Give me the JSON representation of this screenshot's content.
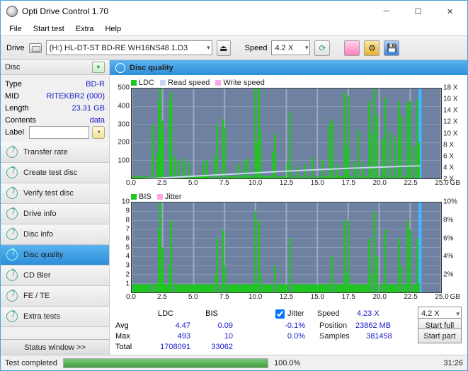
{
  "window": {
    "title": "Opti Drive Control 1.70"
  },
  "menu": {
    "file": "File",
    "start_test": "Start test",
    "extra": "Extra",
    "help": "Help"
  },
  "toolbar": {
    "drive_label": "Drive",
    "drive_value": "(H:)   HL-DT-ST BD-RE  WH16NS48 1.D3",
    "speed_label": "Speed",
    "speed_value": "4.2 X"
  },
  "disc_panel": {
    "header": "Disc",
    "type_k": "Type",
    "type_v": "BD-R",
    "mid_k": "MID",
    "mid_v": "RITEKBR2 (000)",
    "length_k": "Length",
    "length_v": "23.31 GB",
    "contents_k": "Contents",
    "contents_v": "data",
    "label_k": "Label"
  },
  "sidebar": {
    "items": [
      {
        "label": "Transfer rate"
      },
      {
        "label": "Create test disc"
      },
      {
        "label": "Verify test disc"
      },
      {
        "label": "Drive info"
      },
      {
        "label": "Disc info"
      },
      {
        "label": "Disc quality"
      },
      {
        "label": "CD Bler"
      },
      {
        "label": "FE / TE"
      },
      {
        "label": "Extra tests"
      }
    ],
    "status_window": "Status window >>"
  },
  "dq_header": "Disc quality",
  "legend_top": {
    "ldc": "LDC",
    "read": "Read speed",
    "write": "Write speed"
  },
  "legend_bot": {
    "bis": "BIS",
    "jitter": "Jitter"
  },
  "stats": {
    "col_ldc": "LDC",
    "col_bis": "BIS",
    "jitter_chk": "Jitter",
    "speed_k": "Speed",
    "speed_v": "4.23 X",
    "combo_speed": "4.2 X",
    "avg_k": "Avg",
    "avg_ldc": "4.47",
    "avg_bis": "0.09",
    "avg_jit": "-0.1%",
    "max_k": "Max",
    "max_ldc": "493",
    "max_bis": "10",
    "max_jit": "0.0%",
    "pos_k": "Position",
    "pos_v": "23862 MB",
    "total_k": "Total",
    "total_ldc": "1708091",
    "total_bis": "33062",
    "samples_k": "Samples",
    "samples_v": "381458",
    "start_full": "Start full",
    "start_part": "Start part"
  },
  "statusbar": {
    "msg": "Test completed",
    "pct": "100.0%",
    "time": "31:26"
  },
  "chart_data": [
    {
      "type": "bar",
      "title": "LDC / Read speed",
      "xlabel": "GB",
      "ylabel": "LDC",
      "x_range": [
        0,
        25
      ],
      "y_range_left": [
        0,
        500
      ],
      "y_range_right": [
        2,
        18
      ],
      "x_ticks": [
        0.0,
        2.5,
        5.0,
        7.5,
        10.0,
        12.5,
        15.0,
        17.5,
        20.0,
        22.5,
        25.0
      ],
      "y_ticks_left": [
        100,
        200,
        300,
        400,
        500
      ],
      "y_ticks_right": [
        2,
        4,
        6,
        8,
        10,
        12,
        14,
        16,
        18
      ],
      "series": [
        {
          "name": "LDC",
          "color": "#1ec71e",
          "kind": "bar",
          "x": [
            1.7,
            2.1,
            2.2,
            2.3,
            2.4,
            2.5,
            3.1,
            3.2,
            3.5,
            3.8,
            4.2,
            4.6,
            5.8,
            6.1,
            6.7,
            6.9,
            7.4,
            7.5,
            8.6,
            9.1,
            9.4,
            10.0,
            10.1,
            10.3,
            10.4,
            11.4,
            11.6,
            12.6,
            12.8,
            13.4,
            14.0,
            14.6,
            15.4,
            16.0,
            16.2,
            16.6,
            17.2,
            17.4,
            17.5,
            18.0,
            18.3,
            18.7,
            19.2,
            19.4,
            19.6,
            19.8,
            20.3,
            20.5,
            20.9,
            21.3,
            21.6,
            21.8,
            22.3,
            22.5,
            22.8,
            23.1,
            23.2
          ],
          "y": [
            300,
            140,
            430,
            500,
            260,
            320,
            430,
            480,
            120,
            100,
            110,
            90,
            95,
            105,
            120,
            300,
            330,
            280,
            80,
            100,
            110,
            500,
            200,
            500,
            260,
            150,
            250,
            90,
            370,
            70,
            80,
            120,
            100,
            300,
            330,
            80,
            480,
            170,
            460,
            90,
            270,
            90,
            430,
            250,
            500,
            350,
            220,
            450,
            260,
            230,
            430,
            350,
            420,
            430,
            180,
            440,
            200
          ]
        },
        {
          "name": "Read speed",
          "color": "#c8d8f0",
          "kind": "line",
          "x": [
            0,
            2.5,
            5,
            7.5,
            10,
            12.5,
            15,
            17.5,
            20,
            22.5,
            23.3
          ],
          "y_right": [
            1.8,
            2.1,
            2.4,
            2.7,
            3.0,
            3.3,
            3.55,
            3.8,
            4.0,
            4.2,
            4.23
          ]
        }
      ]
    },
    {
      "type": "bar",
      "title": "BIS / Jitter",
      "xlabel": "GB",
      "ylabel": "BIS",
      "x_range": [
        0,
        25
      ],
      "y_range_left": [
        0,
        10
      ],
      "y_range_right": [
        0,
        10
      ],
      "x_ticks": [
        0.0,
        2.5,
        5.0,
        7.5,
        10.0,
        12.5,
        15.0,
        17.5,
        20.0,
        22.5,
        25.0
      ],
      "y_ticks_left": [
        1,
        2,
        3,
        4,
        5,
        6,
        7,
        8,
        9,
        10
      ],
      "y_ticks_right_pct": [
        2,
        4,
        6,
        8,
        10
      ],
      "series": [
        {
          "name": "BIS",
          "color": "#1ec71e",
          "kind": "bar",
          "x": [
            1.7,
            2.1,
            2.2,
            2.3,
            2.4,
            2.5,
            3.1,
            3.2,
            3.5,
            5.8,
            6.8,
            6.9,
            7.4,
            7.5,
            10.0,
            10.1,
            10.3,
            10.4,
            11.6,
            12.8,
            16.0,
            16.2,
            17.2,
            17.4,
            17.5,
            19.2,
            19.4,
            19.6,
            19.8,
            20.3,
            20.5,
            21.6,
            21.8,
            22.3,
            22.5,
            23.1,
            23.2
          ],
          "y": [
            1,
            1,
            7,
            10,
            2,
            5,
            3,
            8,
            1,
            1,
            2,
            6,
            7,
            3,
            9,
            1,
            8,
            2,
            3,
            6,
            1,
            4,
            8,
            2,
            8,
            6,
            2,
            9,
            4,
            1,
            7,
            6,
            3,
            8,
            7,
            6,
            1
          ]
        },
        {
          "name": "Jitter",
          "color": "#f8a8e8",
          "kind": "line",
          "x": [],
          "y_right": []
        }
      ]
    }
  ]
}
